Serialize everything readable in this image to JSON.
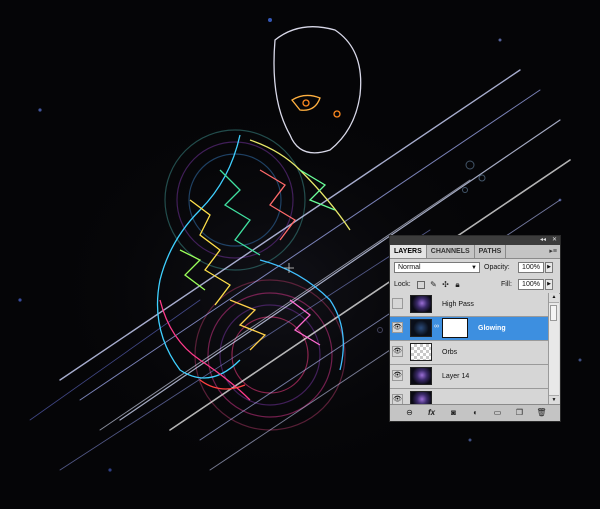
{
  "panel": {
    "tabs": [
      "LAYERS",
      "CHANNELS",
      "PATHS"
    ],
    "active_tab": "LAYERS",
    "blend_mode": "Normal",
    "opacity_label": "Opacity:",
    "opacity_value": "100%",
    "lock_label": "Lock:",
    "fill_label": "Fill:",
    "fill_value": "100%",
    "layers": [
      {
        "name": "High Pass",
        "visible": false,
        "selected": false
      },
      {
        "name": "Glowing",
        "visible": true,
        "selected": true
      },
      {
        "name": "Orbs",
        "visible": true,
        "selected": false
      },
      {
        "name": "Layer 14",
        "visible": true,
        "selected": false
      }
    ],
    "footer_icons": [
      "link-layers-icon",
      "fx-icon",
      "add-mask-icon",
      "adjustment-layer-icon",
      "new-group-icon",
      "new-layer-icon",
      "trash-icon"
    ]
  },
  "colors": {
    "canvas_bg": "#050507",
    "selection": "#3d8fe0",
    "panel_bg": "#d6d6d6"
  }
}
